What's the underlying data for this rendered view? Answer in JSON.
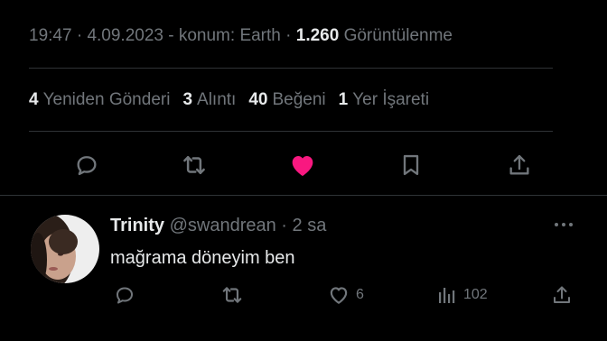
{
  "meta": {
    "time": "19:47",
    "dot1": "·",
    "date": "4.09.2023",
    "location": "- konum: Earth",
    "dot2": "·",
    "views_count": "1.260",
    "views_label": "Görüntülenme"
  },
  "stats": [
    {
      "count": "4",
      "label": "Yeniden Gönderi"
    },
    {
      "count": "3",
      "label": "Alıntı"
    },
    {
      "count": "40",
      "label": "Beğeni"
    },
    {
      "count": "1",
      "label": "Yer İşareti"
    }
  ],
  "colors": {
    "like_active": "#f91880",
    "muted": "#71767b",
    "text": "#e7e9ea",
    "divider": "#2f3336",
    "background": "#000000"
  },
  "actions": [
    "reply-icon",
    "retweet-icon",
    "like-icon",
    "bookmark-icon",
    "share-icon"
  ],
  "reply": {
    "name": "Trinity",
    "handle": "@swandrean",
    "dot": "·",
    "age": "2 sa",
    "text": "mağrama döneyim ben",
    "like_count": "6",
    "view_count": "102"
  }
}
